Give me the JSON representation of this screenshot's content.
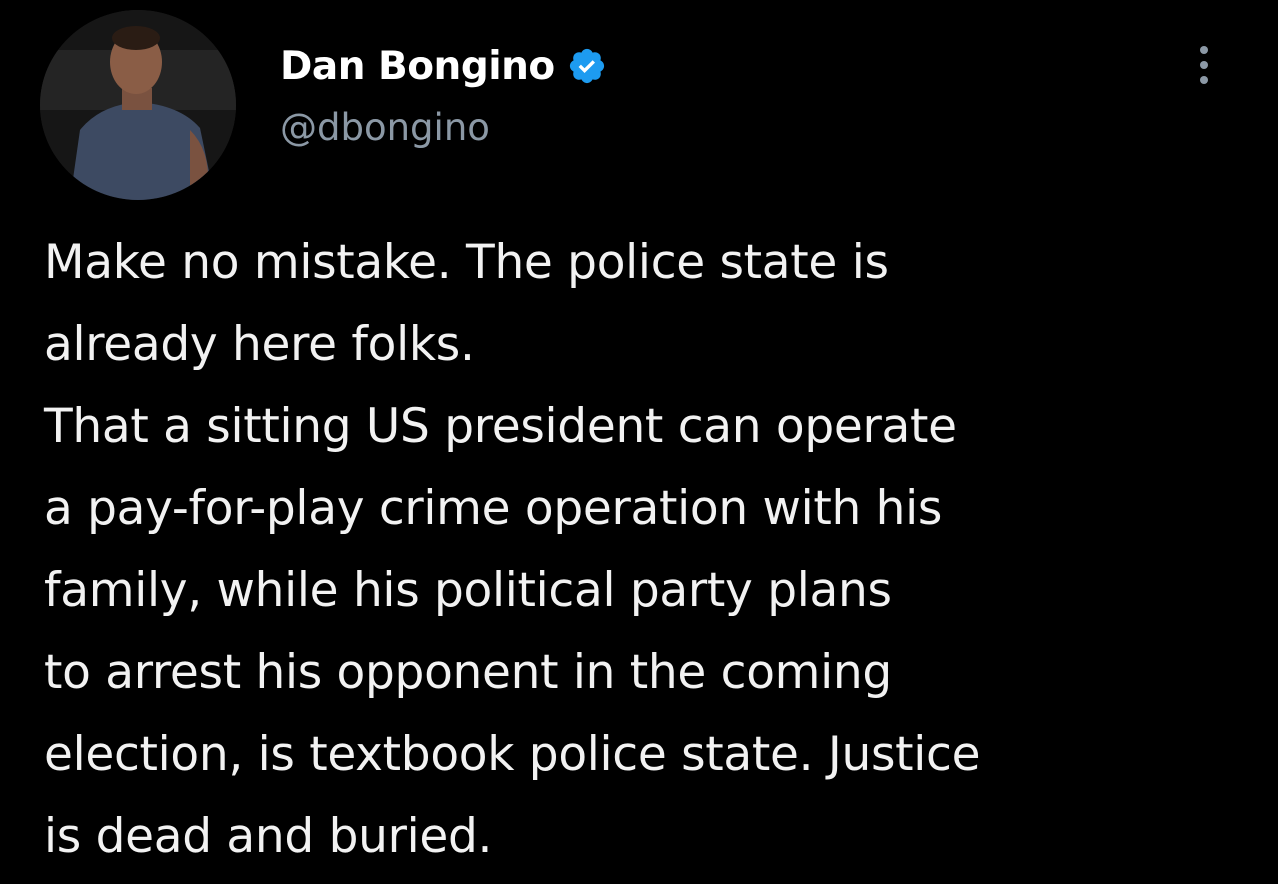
{
  "author": {
    "display_name": "Dan Bongino",
    "handle": "@dbongino",
    "verified": true,
    "verified_color": "#1d9bf0"
  },
  "tweet": {
    "lines": [
      "Make no mistake. The police state is",
      "already here folks.",
      "That a sitting US president can operate",
      "a pay-for-play crime operation with his",
      "family, while his political party plans",
      "to arrest his opponent in the coming",
      "election, is textbook police state. Justice",
      "is dead and buried."
    ]
  },
  "icons": {
    "verified": "verified-badge-icon",
    "more": "more-options-icon"
  }
}
